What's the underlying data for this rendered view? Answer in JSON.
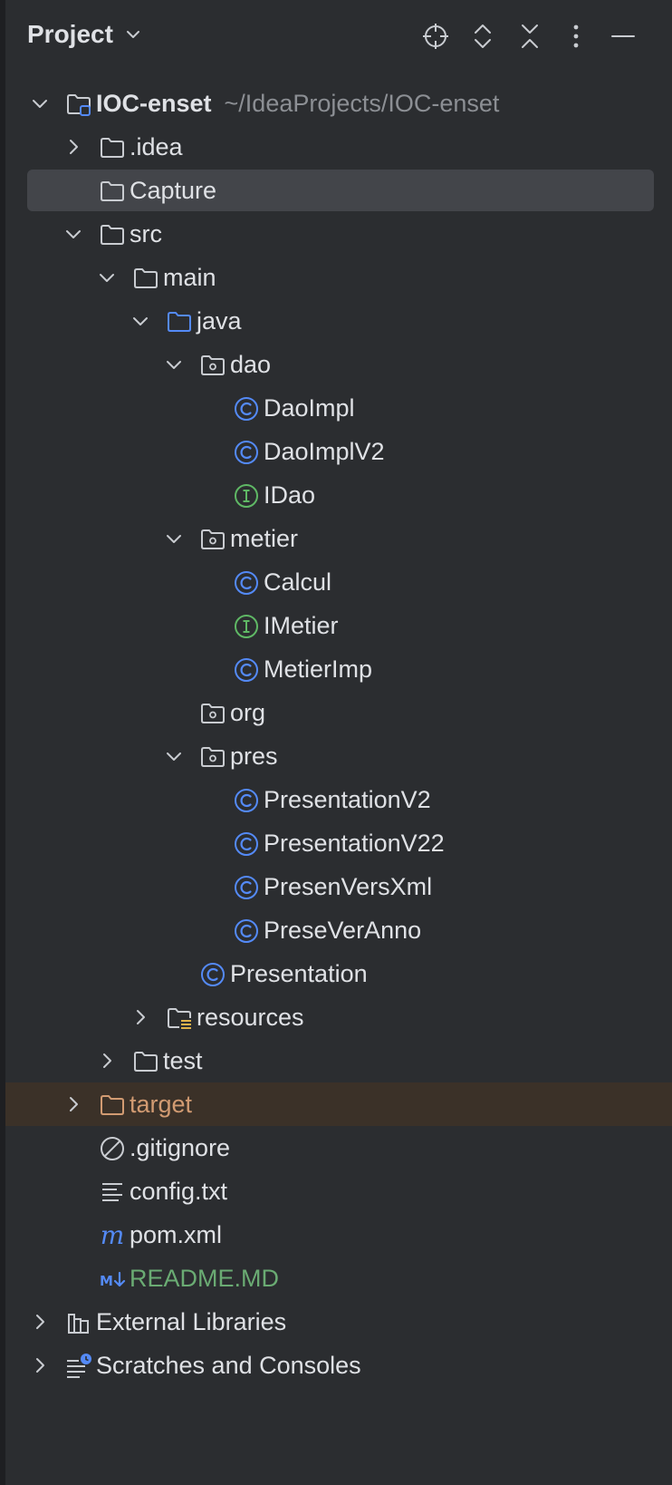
{
  "header": {
    "title": "Project",
    "toolbar": [
      "locate-icon",
      "expand-all-icon",
      "collapse-all-icon",
      "more-options-icon",
      "hide-panel-icon"
    ]
  },
  "tree": [
    {
      "label": "IOC-enset",
      "suffix": "~/IdeaProjects/IOC-enset",
      "icon": "module-folder-icon",
      "expanded": true,
      "depth": 0
    },
    {
      "label": ".idea",
      "icon": "folder-icon",
      "expanded": false,
      "depth": 1
    },
    {
      "label": "Capture",
      "icon": "folder-icon",
      "depth": 1,
      "selected": true
    },
    {
      "label": "src",
      "icon": "folder-icon",
      "expanded": true,
      "depth": 1
    },
    {
      "label": "main",
      "icon": "folder-icon",
      "expanded": true,
      "depth": 2
    },
    {
      "label": "java",
      "icon": "source-folder-icon",
      "expanded": true,
      "depth": 3
    },
    {
      "label": "dao",
      "icon": "package-icon",
      "expanded": true,
      "depth": 4
    },
    {
      "label": "DaoImpl",
      "icon": "class-icon",
      "depth": 5
    },
    {
      "label": "DaoImplV2",
      "icon": "class-icon",
      "depth": 5
    },
    {
      "label": "IDao",
      "icon": "interface-icon",
      "depth": 5
    },
    {
      "label": "metier",
      "icon": "package-icon",
      "expanded": true,
      "depth": 4
    },
    {
      "label": "Calcul",
      "icon": "class-icon",
      "depth": 5
    },
    {
      "label": "IMetier",
      "icon": "interface-icon",
      "depth": 5
    },
    {
      "label": "MetierImp",
      "icon": "class-icon",
      "depth": 5
    },
    {
      "label": "org",
      "icon": "package-icon",
      "depth": 4
    },
    {
      "label": "pres",
      "icon": "package-icon",
      "expanded": true,
      "depth": 4
    },
    {
      "label": "PresentationV2",
      "icon": "class-icon",
      "depth": 5
    },
    {
      "label": "PresentationV22",
      "icon": "class-icon",
      "depth": 5
    },
    {
      "label": "PresenVersXml",
      "icon": "class-icon",
      "depth": 5
    },
    {
      "label": "PreseVerAnno",
      "icon": "class-icon",
      "depth": 5
    },
    {
      "label": "Presentation",
      "icon": "class-icon",
      "depth": 4
    },
    {
      "label": "resources",
      "icon": "resources-folder-icon",
      "expanded": false,
      "depth": 3
    },
    {
      "label": "test",
      "icon": "folder-icon",
      "expanded": false,
      "depth": 2
    },
    {
      "label": "target",
      "icon": "excluded-folder-icon",
      "expanded": false,
      "depth": 1,
      "excluded": true,
      "color": "#d29b72"
    },
    {
      "label": ".gitignore",
      "icon": "gitignore-icon",
      "depth": 1
    },
    {
      "label": "config.txt",
      "icon": "text-file-icon",
      "depth": 1
    },
    {
      "label": "pom.xml",
      "icon": "maven-icon",
      "depth": 1
    },
    {
      "label": "README.MD",
      "icon": "markdown-icon",
      "depth": 1,
      "color": "#6aab73"
    },
    {
      "label": "External Libraries",
      "icon": "libraries-icon",
      "expanded": false,
      "depth": 0
    },
    {
      "label": "Scratches and Consoles",
      "icon": "scratches-icon",
      "expanded": false,
      "depth": 0
    }
  ],
  "colors": {
    "background": "#2b2d30",
    "text": "#dfe1e5",
    "muted": "#8c8f94",
    "selection": "#43454a",
    "excluded_row": "#3b3128",
    "class_icon": "#548af7",
    "interface_icon": "#5fb865",
    "excluded_text": "#d29b72",
    "markdown_text": "#6aab73"
  }
}
